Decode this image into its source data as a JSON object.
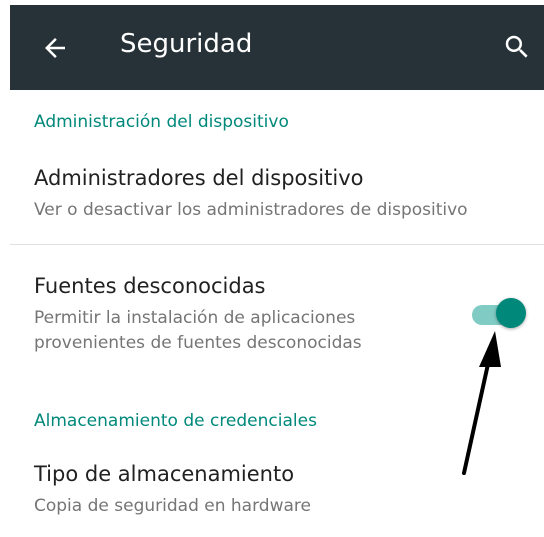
{
  "colors": {
    "app_bar": "#263238",
    "accent": "#00897B",
    "switch_track": "#80CBC4",
    "switch_thumb": "#00897B"
  },
  "header": {
    "title": "Seguridad",
    "back_icon": "arrow-back-icon",
    "search_icon": "search-icon"
  },
  "sections": {
    "device_admin_header": "Administración del dispositivo",
    "credentials_header": "Almacenamiento de credenciales"
  },
  "prefs": {
    "device_admins": {
      "title": "Administradores del dispositivo",
      "summary": "Ver o desactivar los administradores de dispositivo"
    },
    "unknown_sources": {
      "title": "Fuentes desconocidas",
      "summary_line1": "Permitir la instalación de aplicaciones",
      "summary_line2": "provenientes de fuentes desconocidas",
      "enabled": true
    },
    "storage_type": {
      "title": "Tipo de almacenamiento",
      "summary": "Copia de seguridad en hardware"
    }
  },
  "annotation": {
    "arrow_icon": "pointer-arrow-icon"
  }
}
